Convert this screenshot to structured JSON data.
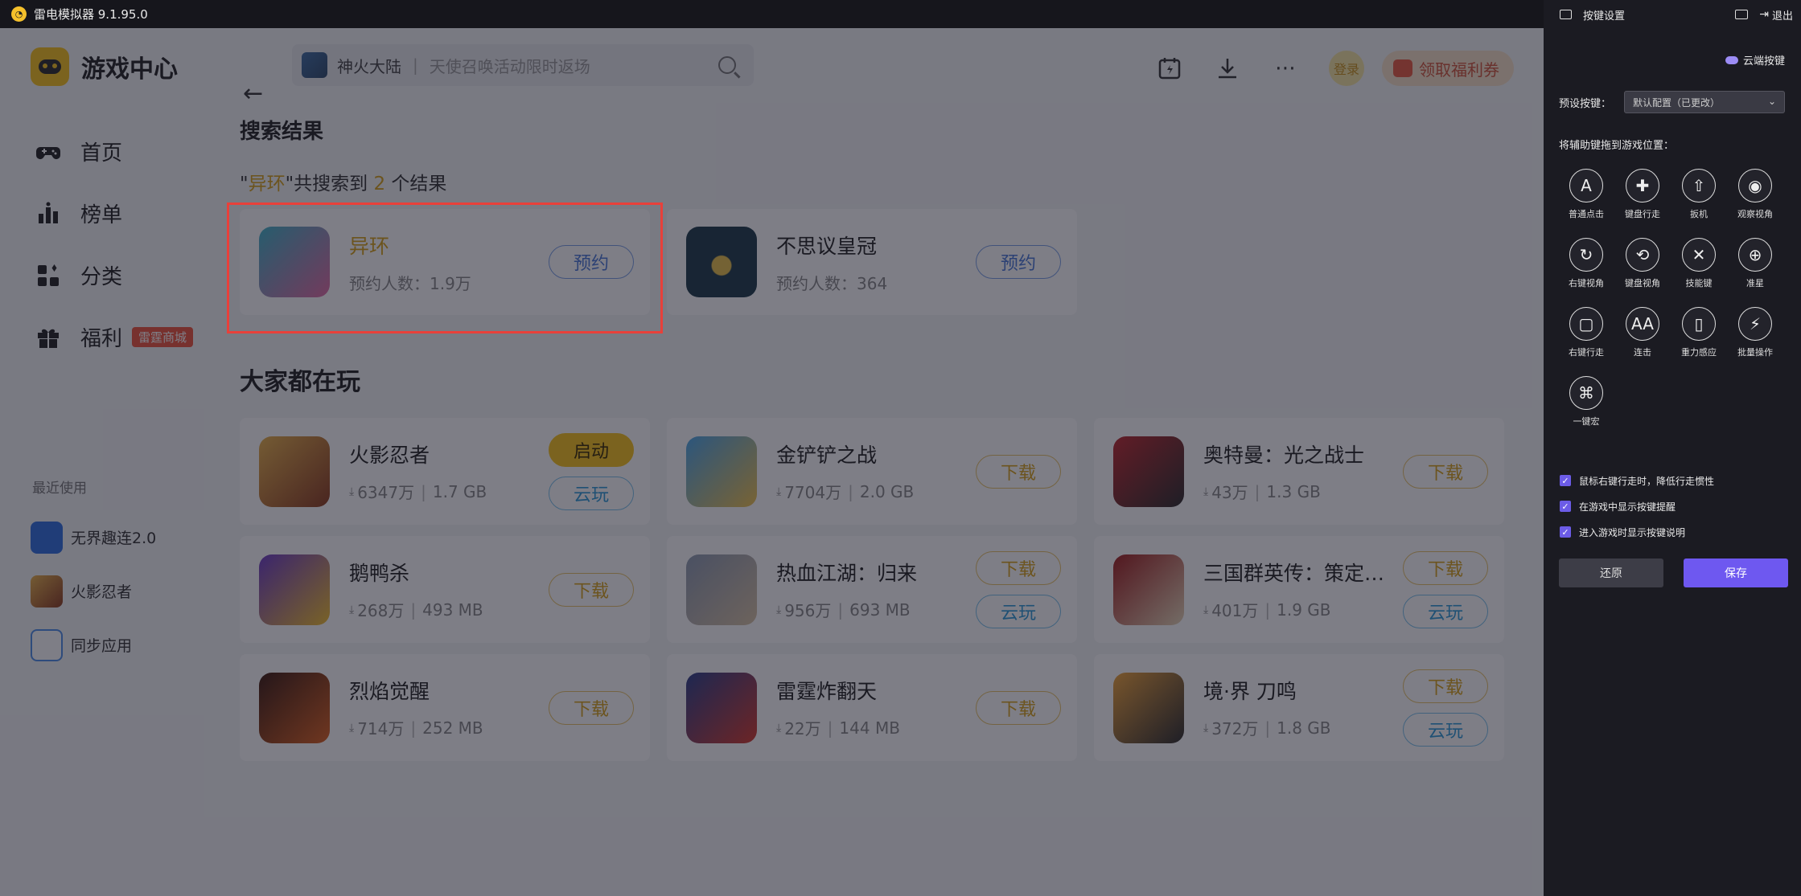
{
  "window": {
    "title": "雷电模拟器 9.1.95.0"
  },
  "game_center": {
    "title": "游戏中心",
    "nav": [
      {
        "label": "首页",
        "icon": "gamepad-icon"
      },
      {
        "label": "榜单",
        "icon": "ranking-icon"
      },
      {
        "label": "分类",
        "icon": "category-icon"
      },
      {
        "label": "福利",
        "icon": "gift-icon",
        "badge": "雷霆商城"
      }
    ],
    "recent_title": "最近使用",
    "recent": [
      {
        "label": "无界趣连2.0",
        "color": "#2f6fe0"
      },
      {
        "label": "火影忍者",
        "color": "#d9822b"
      },
      {
        "label": "同步应用",
        "color": "#4f8fe8"
      }
    ]
  },
  "search": {
    "game": "神火大陆",
    "hint": "天使召唤活动限时返场"
  },
  "topbar": {
    "login": "登录",
    "coupon": "领取福利券"
  },
  "results": {
    "title": "搜索结果",
    "count_prefix": "\"",
    "count_keyword": "异环",
    "count_mid": "\"共搜索到 ",
    "count_num": "2",
    "count_suffix": " 个结果",
    "items": [
      {
        "title": "异环",
        "sub": "预约人数：1.9万",
        "button": "预约",
        "color_a": "#3fb4c9",
        "color_b": "#e56aa3"
      },
      {
        "title": "不思议皇冠",
        "sub": "预约人数：364",
        "button": "预约",
        "color_a": "#1d3a4a",
        "color_b": "#e8c24a"
      }
    ]
  },
  "popular": {
    "title": "大家都在玩",
    "items": [
      {
        "title": "火影忍者",
        "downloads": "6347万",
        "size": "1.7 GB",
        "buttons": [
          "启动",
          "云玩"
        ],
        "color_a": "#e9b24a",
        "color_b": "#8a3a1e"
      },
      {
        "title": "金铲铲之战",
        "downloads": "7704万",
        "size": "2.0 GB",
        "buttons": [
          "下载"
        ],
        "color_a": "#4aa6e9",
        "color_b": "#f3c34a"
      },
      {
        "title": "奥特曼：光之战士",
        "downloads": "43万",
        "size": "1.3 GB",
        "buttons": [
          "下载"
        ],
        "color_a": "#c0282d",
        "color_b": "#2b2b2b"
      },
      {
        "title": "鹅鸭杀",
        "downloads": "268万",
        "size": "493 MB",
        "buttons": [
          "下载"
        ],
        "color_a": "#6a3ac7",
        "color_b": "#f5c22c"
      },
      {
        "title": "热血江湖：归来",
        "downloads": "956万",
        "size": "693 MB",
        "buttons": [
          "下载",
          "云玩"
        ],
        "color_a": "#8c9ab1",
        "color_b": "#d9c3a3"
      },
      {
        "title": "三国群英传：策定九州",
        "downloads": "401万",
        "size": "1.9 GB",
        "buttons": [
          "下载",
          "云玩"
        ],
        "color_a": "#9e1c1c",
        "color_b": "#e8d8b8"
      },
      {
        "title": "烈焰觉醒",
        "downloads": "714万",
        "size": "252 MB",
        "buttons": [
          "下载"
        ],
        "color_a": "#3a1a10",
        "color_b": "#e0621e"
      },
      {
        "title": "雷霆炸翻天",
        "downloads": "22万",
        "size": "144 MB",
        "buttons": [
          "下载"
        ],
        "color_a": "#2a3f8a",
        "color_b": "#d83a2a"
      },
      {
        "title": "境·界 刀鸣",
        "downloads": "372万",
        "size": "1.8 GB",
        "buttons": [
          "下载",
          "云玩"
        ],
        "color_a": "#f1a53a",
        "color_b": "#2c2c2c"
      }
    ]
  },
  "panel": {
    "title": "按键设置",
    "exit": "退出",
    "cloud_keys": "云端按键",
    "preset_label": "预设按键：",
    "preset_value": "默认配置（已更改）",
    "drag_hint": "将辅助键拖到游戏位置：",
    "keys": [
      {
        "label": "普通点击",
        "glyph": "A",
        "icon": "tap-icon"
      },
      {
        "label": "键盘行走",
        "glyph": "✚",
        "icon": "dpad-icon"
      },
      {
        "label": "扳机",
        "glyph": "⇧",
        "icon": "trigger-icon"
      },
      {
        "label": "观察视角",
        "glyph": "◉",
        "icon": "eye-icon"
      },
      {
        "label": "右键视角",
        "glyph": "↻",
        "icon": "rclick-view-icon"
      },
      {
        "label": "键盘视角",
        "glyph": "⟲",
        "icon": "keyboard-view-icon"
      },
      {
        "label": "技能键",
        "glyph": "✕",
        "icon": "skill-icon"
      },
      {
        "label": "准星",
        "glyph": "⊕",
        "icon": "crosshair-icon"
      },
      {
        "label": "右键行走",
        "glyph": "▢",
        "icon": "mouse-walk-icon"
      },
      {
        "label": "连击",
        "glyph": "AA",
        "icon": "combo-icon"
      },
      {
        "label": "重力感应",
        "glyph": "▯",
        "icon": "gravity-icon"
      },
      {
        "label": "批量操作",
        "glyph": "⚡",
        "icon": "batch-icon"
      },
      {
        "label": "一键宏",
        "glyph": "⌘",
        "icon": "macro-icon"
      }
    ],
    "checks": [
      "鼠标右键行走时，降低行走惯性",
      "在游戏中显示按键提醒",
      "进入游戏时显示按键说明"
    ],
    "reset": "还原",
    "save": "保存"
  }
}
